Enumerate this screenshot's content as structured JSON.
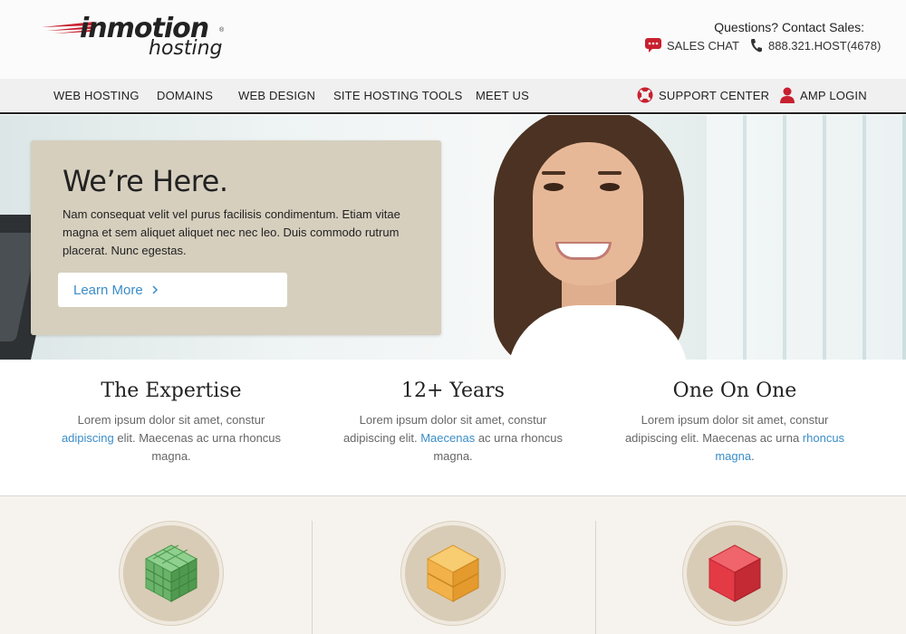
{
  "header": {
    "logo_brand": "inmotion",
    "logo_sub": "hosting",
    "logo_reg": "®",
    "contact_question": "Questions? Contact Sales:",
    "sales_chat": "SALES CHAT",
    "phone": "888.321.HOST(4678)"
  },
  "nav": {
    "items": [
      "WEB HOSTING",
      "DOMAINS",
      "WEB DESIGN",
      "SITE HOSTING TOOLS",
      "MEET US"
    ],
    "support": "SUPPORT CENTER",
    "login": "AMP LOGIN"
  },
  "hero": {
    "title": "We’re Here.",
    "body": "Nam consequat velit vel purus facilisis condimentum. Etiam vitae magna et sem aliquet aliquet nec nec leo. Duis commodo rutrum placerat. Nunc egestas.",
    "button": "Learn More"
  },
  "features": [
    {
      "title": "The Expertise",
      "pre": "Lorem ipsum dolor sit amet, constur ",
      "link": "adipiscing",
      "post": " elit. Maecenas ac urna rhoncus magna."
    },
    {
      "title": "12+ Years",
      "pre": "Lorem ipsum dolor sit amet, constur adipiscing elit. ",
      "link": "Maecenas",
      "post": " ac urna rhoncus magna."
    },
    {
      "title": "One On One",
      "pre": "Lorem ipsum dolor sit amet, constur adipiscing elit. Maecenas ac urna ",
      "link": "rhoncus magna",
      "post": "."
    }
  ],
  "icons": [
    "green-cube-icon",
    "orange-cube-icon",
    "red-cube-icon"
  ],
  "colors": {
    "accent": "#3a8dc8",
    "brand_red": "#c8202f",
    "card": "#d6cfbe",
    "green": "#6ab36a",
    "orange": "#f3b14a",
    "red": "#e43a45"
  }
}
